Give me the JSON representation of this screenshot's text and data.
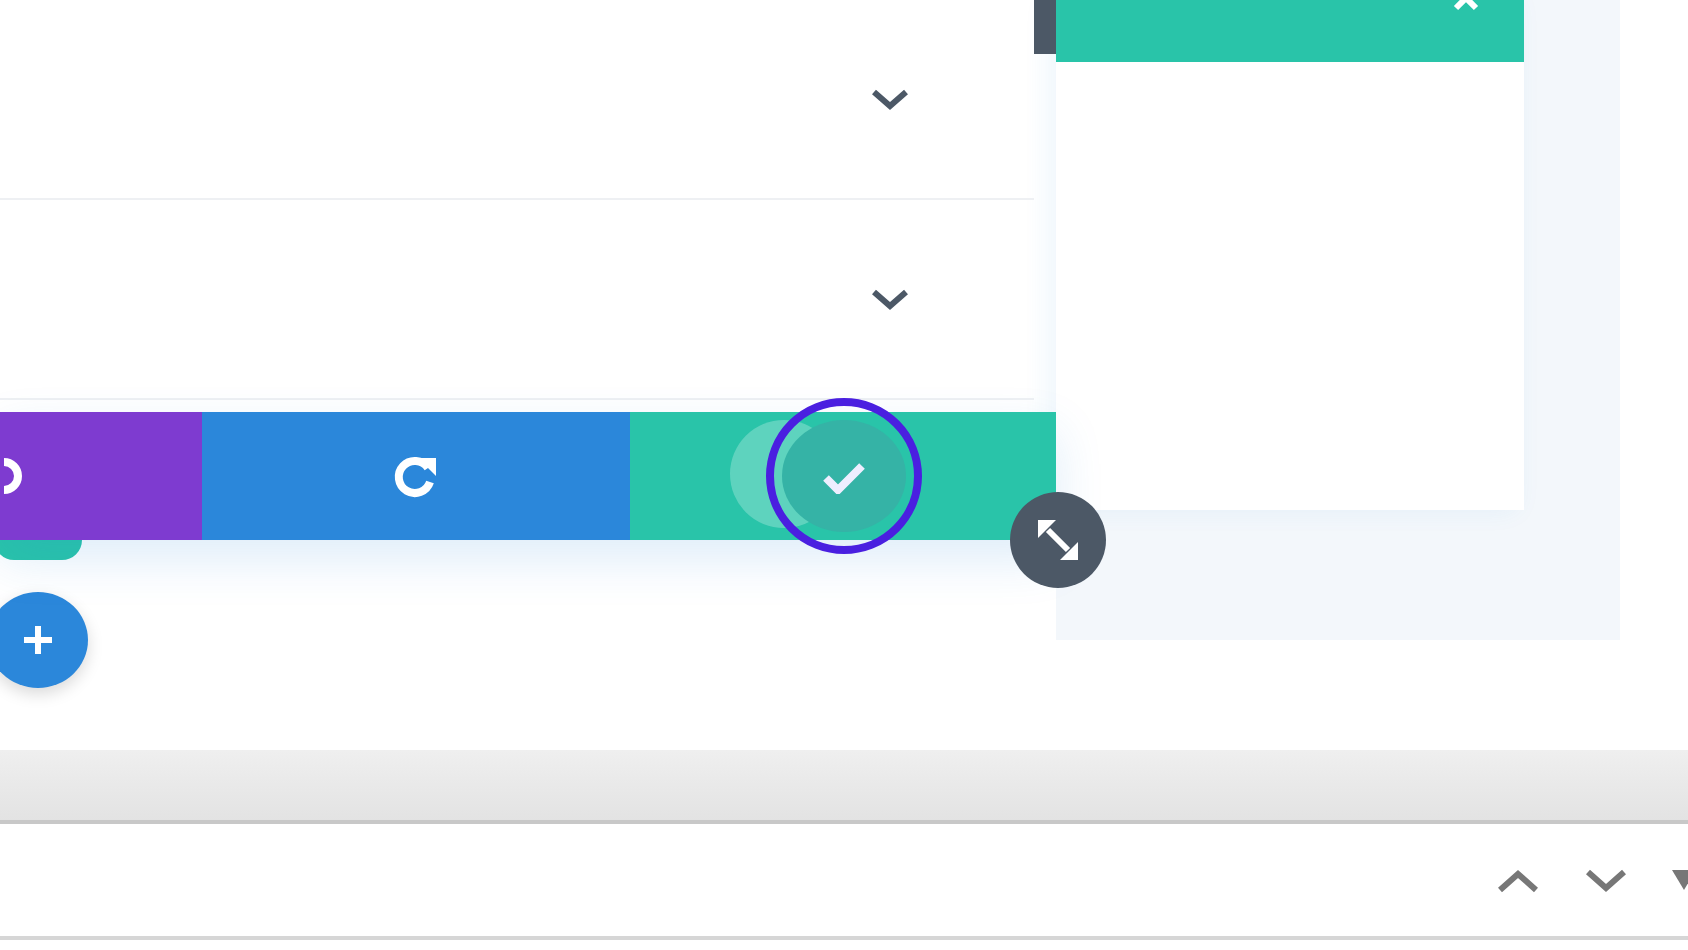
{
  "settings_rows": [
    {
      "expanded": false
    },
    {
      "expanded": false
    }
  ],
  "action_bar": [
    {
      "kind": "undo",
      "focused": false
    },
    {
      "kind": "redo",
      "focused": false
    },
    {
      "kind": "save",
      "focused": true
    }
  ]
}
